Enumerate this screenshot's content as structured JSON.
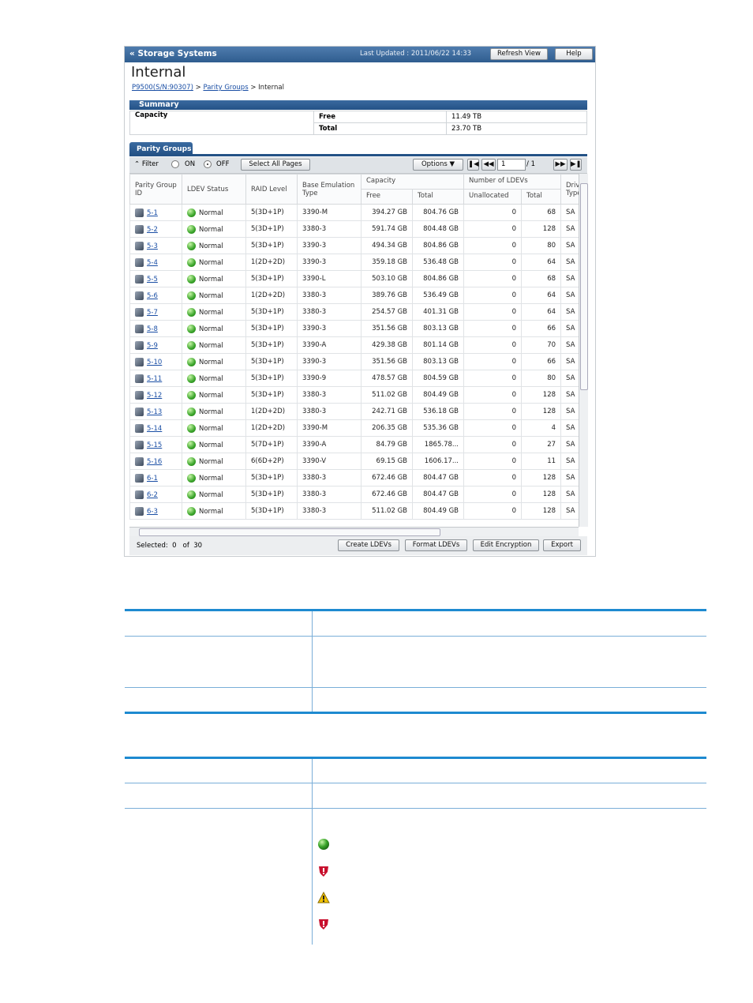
{
  "header": {
    "title": "Storage Systems",
    "last_updated": "Last Updated : 2011/06/22 14:33",
    "refresh_label": "Refresh View",
    "help_label": "Help"
  },
  "page": {
    "title": "Internal",
    "breadcrumb": [
      "P9500(S/N:90307)",
      "Parity Groups",
      "Internal"
    ],
    "breadcrumb_sep": ">"
  },
  "summary": {
    "title": "Summary",
    "capacity_label": "Capacity",
    "free_label": "Free",
    "free_value": "11.49 TB",
    "total_label": "Total",
    "total_value": "23.70 TB"
  },
  "tab": {
    "label": "Parity Groups"
  },
  "toolbar": {
    "filter_label": "Filter",
    "on_label": "ON",
    "off_label": "OFF",
    "filter_selected": "OFF",
    "select_all_label": "Select All Pages",
    "options_label": "Options",
    "page_value": "1",
    "page_total": "/ 1"
  },
  "columns": {
    "parity_group_id": "Parity Group ID",
    "ldev_status": "LDEV Status",
    "raid_level": "RAID Level",
    "emulation": "Base Emulation Type",
    "capacity": "Capacity",
    "cap_free": "Free",
    "cap_total": "Total",
    "num_ldevs": "Number of LDEVs",
    "unallocated": "Unallocated",
    "ldev_total": "Total",
    "drive_type": "Drive Type"
  },
  "rows": [
    {
      "id": "5-1",
      "status": "Normal",
      "raid": "5(3D+1P)",
      "emu": "3390-M",
      "free": "394.27 GB",
      "total": "804.76 GB",
      "unalloc": "0",
      "ldevs": "68",
      "drive": "SA"
    },
    {
      "id": "5-2",
      "status": "Normal",
      "raid": "5(3D+1P)",
      "emu": "3380-3",
      "free": "591.74 GB",
      "total": "804.48 GB",
      "unalloc": "0",
      "ldevs": "128",
      "drive": "SA"
    },
    {
      "id": "5-3",
      "status": "Normal",
      "raid": "5(3D+1P)",
      "emu": "3390-3",
      "free": "494.34 GB",
      "total": "804.86 GB",
      "unalloc": "0",
      "ldevs": "80",
      "drive": "SA"
    },
    {
      "id": "5-4",
      "status": "Normal",
      "raid": "1(2D+2D)",
      "emu": "3390-3",
      "free": "359.18 GB",
      "total": "536.48 GB",
      "unalloc": "0",
      "ldevs": "64",
      "drive": "SA"
    },
    {
      "id": "5-5",
      "status": "Normal",
      "raid": "5(3D+1P)",
      "emu": "3390-L",
      "free": "503.10 GB",
      "total": "804.86 GB",
      "unalloc": "0",
      "ldevs": "68",
      "drive": "SA"
    },
    {
      "id": "5-6",
      "status": "Normal",
      "raid": "1(2D+2D)",
      "emu": "3380-3",
      "free": "389.76 GB",
      "total": "536.49 GB",
      "unalloc": "0",
      "ldevs": "64",
      "drive": "SA"
    },
    {
      "id": "5-7",
      "status": "Normal",
      "raid": "5(3D+1P)",
      "emu": "3380-3",
      "free": "254.57 GB",
      "total": "401.31 GB",
      "unalloc": "0",
      "ldevs": "64",
      "drive": "SA"
    },
    {
      "id": "5-8",
      "status": "Normal",
      "raid": "5(3D+1P)",
      "emu": "3390-3",
      "free": "351.56 GB",
      "total": "803.13 GB",
      "unalloc": "0",
      "ldevs": "66",
      "drive": "SA"
    },
    {
      "id": "5-9",
      "status": "Normal",
      "raid": "5(3D+1P)",
      "emu": "3390-A",
      "free": "429.38 GB",
      "total": "801.14 GB",
      "unalloc": "0",
      "ldevs": "70",
      "drive": "SA"
    },
    {
      "id": "5-10",
      "status": "Normal",
      "raid": "5(3D+1P)",
      "emu": "3390-3",
      "free": "351.56 GB",
      "total": "803.13 GB",
      "unalloc": "0",
      "ldevs": "66",
      "drive": "SA"
    },
    {
      "id": "5-11",
      "status": "Normal",
      "raid": "5(3D+1P)",
      "emu": "3390-9",
      "free": "478.57 GB",
      "total": "804.59 GB",
      "unalloc": "0",
      "ldevs": "80",
      "drive": "SA"
    },
    {
      "id": "5-12",
      "status": "Normal",
      "raid": "5(3D+1P)",
      "emu": "3380-3",
      "free": "511.02 GB",
      "total": "804.49 GB",
      "unalloc": "0",
      "ldevs": "128",
      "drive": "SA"
    },
    {
      "id": "5-13",
      "status": "Normal",
      "raid": "1(2D+2D)",
      "emu": "3380-3",
      "free": "242.71 GB",
      "total": "536.18 GB",
      "unalloc": "0",
      "ldevs": "128",
      "drive": "SA"
    },
    {
      "id": "5-14",
      "status": "Normal",
      "raid": "1(2D+2D)",
      "emu": "3390-M",
      "free": "206.35 GB",
      "total": "535.36 GB",
      "unalloc": "0",
      "ldevs": "4",
      "drive": "SA"
    },
    {
      "id": "5-15",
      "status": "Normal",
      "raid": "5(7D+1P)",
      "emu": "3390-A",
      "free": "84.79 GB",
      "total": "1865.78...",
      "unalloc": "0",
      "ldevs": "27",
      "drive": "SA"
    },
    {
      "id": "5-16",
      "status": "Normal",
      "raid": "6(6D+2P)",
      "emu": "3390-V",
      "free": "69.15 GB",
      "total": "1606.17...",
      "unalloc": "0",
      "ldevs": "11",
      "drive": "SA"
    },
    {
      "id": "6-1",
      "status": "Normal",
      "raid": "5(3D+1P)",
      "emu": "3380-3",
      "free": "672.46 GB",
      "total": "804.47 GB",
      "unalloc": "0",
      "ldevs": "128",
      "drive": "SA"
    },
    {
      "id": "6-2",
      "status": "Normal",
      "raid": "5(3D+1P)",
      "emu": "3380-3",
      "free": "672.46 GB",
      "total": "804.47 GB",
      "unalloc": "0",
      "ldevs": "128",
      "drive": "SA"
    },
    {
      "id": "6-3",
      "status": "Normal",
      "raid": "5(3D+1P)",
      "emu": "3380-3",
      "free": "511.02 GB",
      "total": "804.49 GB",
      "unalloc": "0",
      "ldevs": "128",
      "drive": "SA"
    }
  ],
  "footer": {
    "selected_label": "Selected:",
    "selected_count": "0",
    "of_label": "of",
    "total_count": "30",
    "create_label": "Create LDEVs",
    "format_label": "Format LDEVs",
    "encrypt_label": "Edit Encryption",
    "export_label": "Export"
  },
  "colors": {
    "accent": "#245286",
    "title_bar": "#3b6a9e",
    "table_rule": "#7aaed8",
    "status_green": "#3aa52a",
    "error_red": "#c8102e",
    "warning_yellow": "#f2c200"
  },
  "doc_icons": [
    "green-circle-icon",
    "red-shield-error-icon",
    "yellow-warning-icon",
    "red-shield-error-icon"
  ]
}
